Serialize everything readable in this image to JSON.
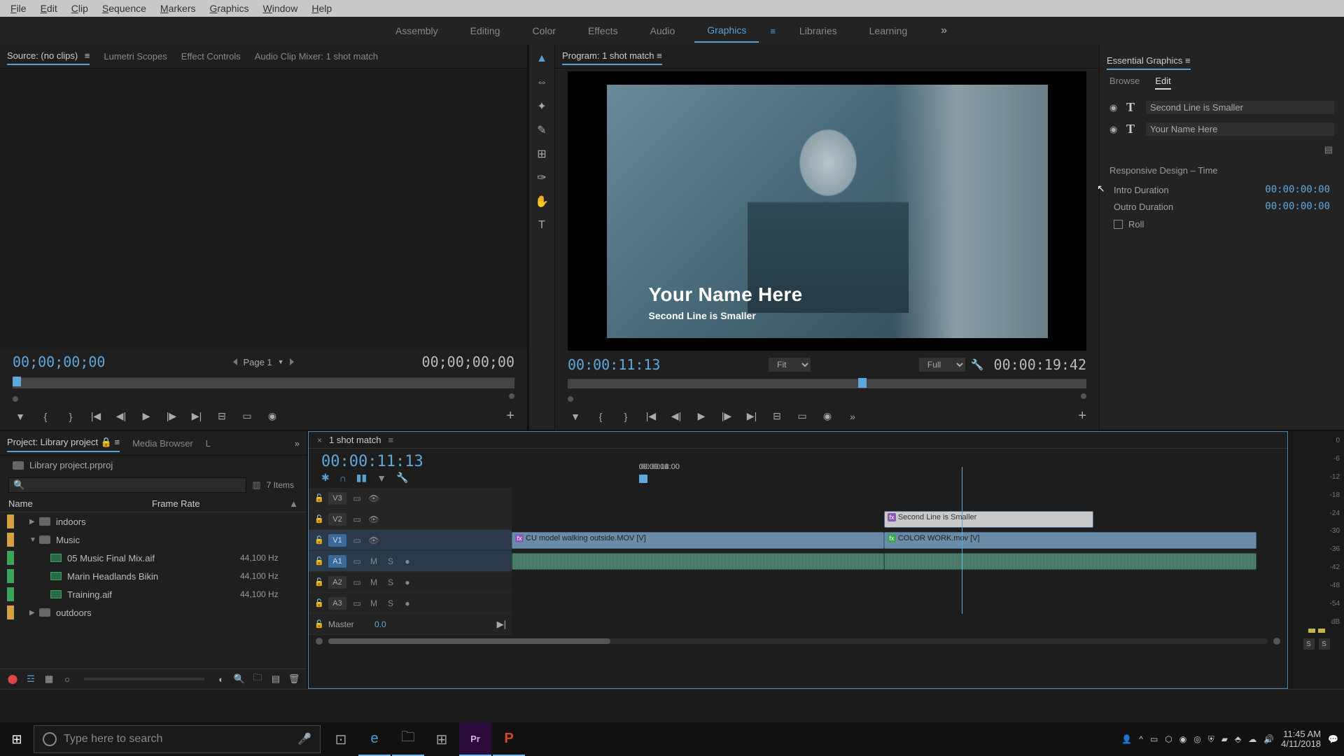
{
  "menubar": [
    "File",
    "Edit",
    "Clip",
    "Sequence",
    "Markers",
    "Graphics",
    "Window",
    "Help"
  ],
  "workspaces": {
    "tabs": [
      "Assembly",
      "Editing",
      "Color",
      "Effects",
      "Audio",
      "Graphics",
      "Libraries",
      "Learning"
    ],
    "active": "Graphics"
  },
  "source": {
    "tabs": [
      "Source: (no clips)",
      "Lumetri Scopes",
      "Effect Controls",
      "Audio Clip Mixer: 1 shot match"
    ],
    "active": 0,
    "tc_left": "00;00;00;00",
    "tc_right": "00;00;00;00",
    "page_label": "Page 1"
  },
  "program": {
    "title": "Program: 1 shot match",
    "overlay_title": "Your Name Here",
    "overlay_sub": "Second Line is Smaller",
    "tc_left": "00:00:11:13",
    "tc_right": "00:00:19:42",
    "fit": "Fit",
    "quality": "Full"
  },
  "essential": {
    "title": "Essential Graphics",
    "tabs": [
      "Browse",
      "Edit"
    ],
    "active": 1,
    "layers": [
      {
        "label": "Second Line is Smaller"
      },
      {
        "label": "Your Name Here"
      }
    ],
    "section": "Responsive Design – Time",
    "intro_label": "Intro Duration",
    "intro_val": "00:00:00:00",
    "outro_label": "Outro Duration",
    "outro_val": "00:00:00:00",
    "roll": "Roll"
  },
  "project": {
    "tabs": [
      "Project: Library project",
      "Media Browser",
      "L"
    ],
    "file": "Library project.prproj",
    "item_count": "7 Items",
    "col1": "Name",
    "col2": "Frame Rate",
    "rows": [
      {
        "type": "bin",
        "name": "indoors",
        "tag": "or",
        "twisty": "▶",
        "indent": 1
      },
      {
        "type": "bin",
        "name": "Music",
        "tag": "or",
        "twisty": "▼",
        "indent": 1
      },
      {
        "type": "clip",
        "name": "05 Music Final Mix.aif",
        "tag": "gr",
        "rate": "44,100 Hz",
        "indent": 2
      },
      {
        "type": "clip",
        "name": "Marin Headlands Bikin",
        "tag": "gr",
        "rate": "44,100 Hz",
        "indent": 2
      },
      {
        "type": "clip",
        "name": "Training.aif",
        "tag": "gr",
        "rate": "44,100 Hz",
        "indent": 2
      },
      {
        "type": "bin",
        "name": "outdoors",
        "tag": "or",
        "twisty": "▶",
        "indent": 1
      }
    ]
  },
  "timeline": {
    "name": "1 shot match",
    "tc": "00:00:11:13",
    "ticks": [
      {
        "label": ":00:00",
        "pct": 0
      },
      {
        "label": "00:00:04:00",
        "pct": 20
      },
      {
        "label": "00:00:08:00",
        "pct": 40
      },
      {
        "label": "00:00:12:00",
        "pct": 60
      },
      {
        "label": "00:00:16:00",
        "pct": 80
      }
    ],
    "playhead_pct": 58,
    "tracks": {
      "v3": "V3",
      "v2": "V2",
      "v1": "V1",
      "a1": "A1",
      "a2": "A2",
      "a3": "A3",
      "master": "Master",
      "master_val": "0.0"
    },
    "clips": {
      "v2_graphic": "Second Line is Smaller",
      "v1_a": "CU model walking outside.MOV [V]",
      "v1_b": "COLOR WORK.mov [V]"
    }
  },
  "meters": {
    "scale": [
      "0",
      "-6",
      "-12",
      "-18",
      "-24",
      "-30",
      "-36",
      "-42",
      "-48",
      "-54",
      "dB"
    ]
  },
  "taskbar": {
    "search_placeholder": "Type here to search",
    "time": "11:45 AM",
    "date": "4/11/2018"
  }
}
